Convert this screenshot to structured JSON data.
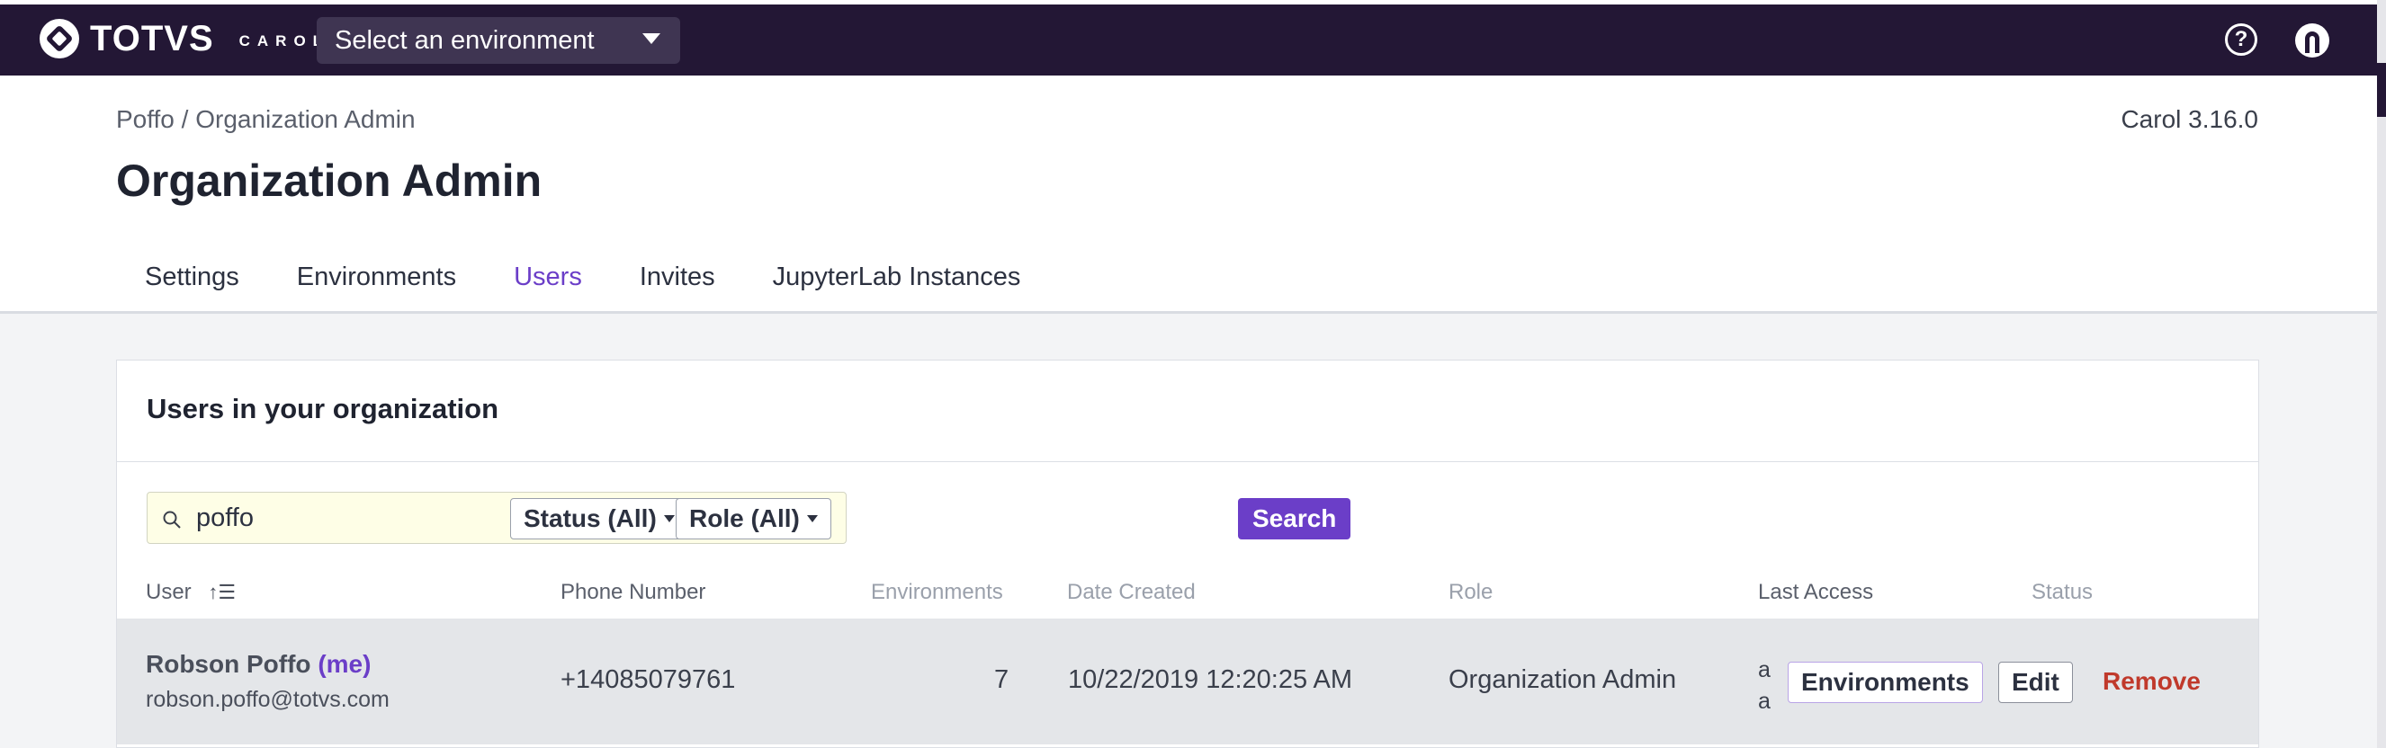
{
  "header": {
    "brand": "TOTVS",
    "brand_sub": "CAROL",
    "env_select_label": "Select an environment"
  },
  "page": {
    "breadcrumb": "Poffo / Organization Admin",
    "version": "Carol 3.16.0",
    "title": "Organization Admin"
  },
  "tabs": [
    {
      "label": "Settings"
    },
    {
      "label": "Environments"
    },
    {
      "label": "Users",
      "active": true
    },
    {
      "label": "Invites"
    },
    {
      "label": "JupyterLab Instances"
    }
  ],
  "users_card": {
    "title": "Users in your organization",
    "search_value": "poffo",
    "status_filter": "Status (All)",
    "role_filter": "Role (All)",
    "search_button": "Search",
    "columns": [
      "User",
      "Phone Number",
      "Environments",
      "Date Created",
      "Role",
      "Last Access",
      "Status"
    ],
    "rows": [
      {
        "name": "Robson Poffo",
        "me_tag": "(me)",
        "email": "robson.poffo@totvs.com",
        "phone": "+14085079761",
        "environments": "7",
        "date_created": "10/22/2019 12:20:25 AM",
        "role": "Organization Admin",
        "last_access_line1": "a",
        "last_access_line2": "a",
        "env_button": "Environments",
        "edit_button": "Edit",
        "remove_link": "Remove"
      }
    ]
  },
  "colors": {
    "topbar": "#231735",
    "accent": "#6b3ec8",
    "danger": "#c0392b"
  }
}
